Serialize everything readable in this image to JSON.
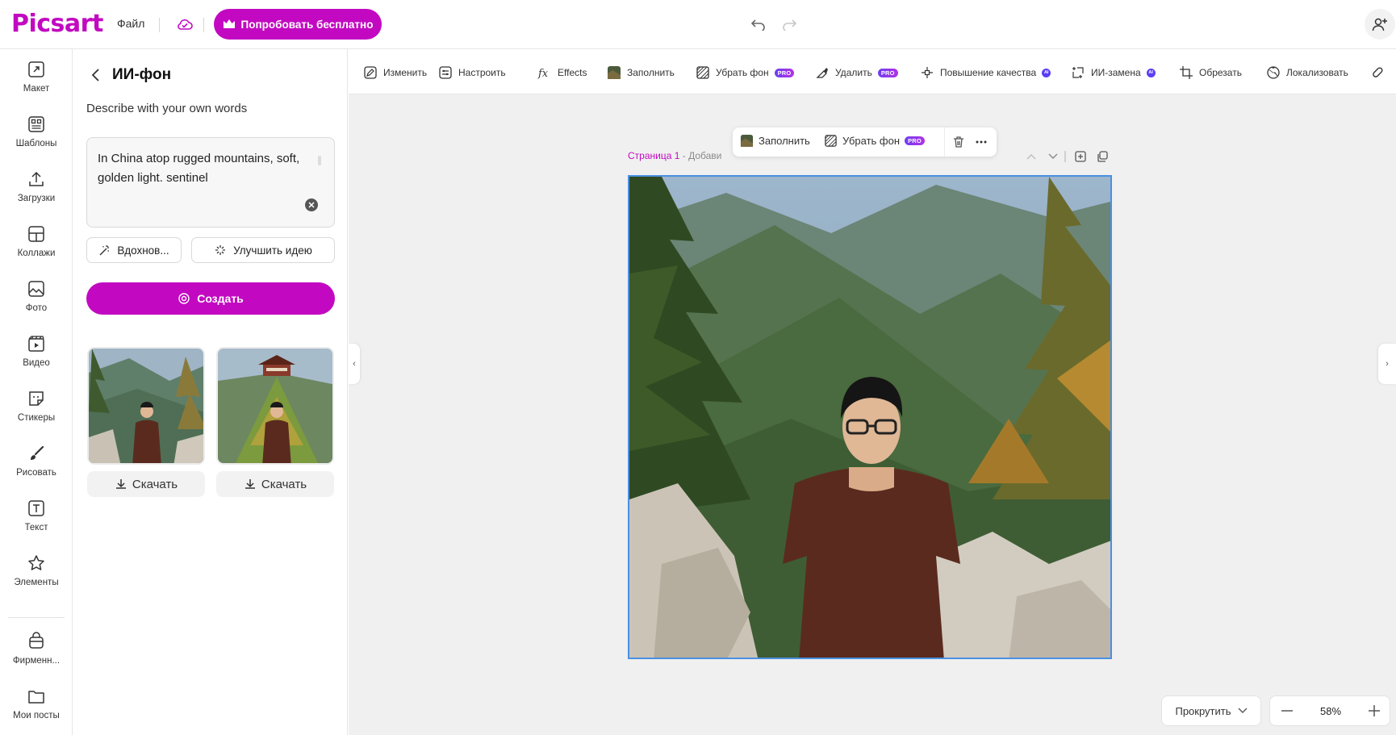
{
  "header": {
    "logo": "Picsart",
    "file_menu": "Файл",
    "try_free": "Попробовать бесплатно"
  },
  "left_nav": [
    {
      "label": "Макет",
      "icon": "layout-icon"
    },
    {
      "label": "Шаблоны",
      "icon": "templates-icon"
    },
    {
      "label": "Загрузки",
      "icon": "upload-icon"
    },
    {
      "label": "Коллажи",
      "icon": "collage-icon"
    },
    {
      "label": "Фото",
      "icon": "photo-icon"
    },
    {
      "label": "Видео",
      "icon": "video-icon"
    },
    {
      "label": "Стикеры",
      "icon": "sticker-icon"
    },
    {
      "label": "Рисовать",
      "icon": "brush-icon"
    },
    {
      "label": "Текст",
      "icon": "text-icon"
    },
    {
      "label": "Элементы",
      "icon": "star-icon"
    },
    {
      "label": "Фирменн...",
      "icon": "brand-kit-icon"
    },
    {
      "label": "Мои посты",
      "icon": "folder-icon"
    }
  ],
  "panel": {
    "title": "ИИ-фон",
    "subtitle": "Describe with your own words",
    "prompt_value": "In China atop rugged mountains, soft, golden light. sentinel",
    "inspire_label": "Вдохнов...",
    "improve_label": "Улучшить идею",
    "create_label": "Создать",
    "results": [
      {
        "download_label": "Скачать"
      },
      {
        "download_label": "Скачать"
      }
    ]
  },
  "toolbar": {
    "tools": [
      {
        "label": "Изменить",
        "icon": "edit-icon"
      },
      {
        "label": "Настроить",
        "icon": "adjust-icon"
      },
      {
        "label": "Effects",
        "icon": "fx-icon"
      },
      {
        "label": "Заполнить",
        "icon": "fill-icon"
      },
      {
        "label": "Убрать фон",
        "icon": "remove-bg-icon",
        "badge": "PRO"
      },
      {
        "label": "Удалить",
        "icon": "eraser-icon",
        "badge": "PRO"
      },
      {
        "label": "Повышение качества",
        "icon": "enhance-icon",
        "badge": "AI"
      },
      {
        "label": "ИИ-замена",
        "icon": "replace-icon",
        "badge": "AI"
      },
      {
        "label": "Обрезать",
        "icon": "crop-icon"
      },
      {
        "label": "Локализовать",
        "icon": "globe-icon"
      }
    ]
  },
  "canvas": {
    "page_label": "Страница 1",
    "page_add": " - Добави",
    "float_fill": "Заполнить",
    "float_remove_bg": "Убрать фон",
    "float_pro": "PRO",
    "scroll_label": "Прокрутить",
    "zoom": "58%"
  },
  "colors": {
    "brand": "#c209c1",
    "pro_badge": "#6d3ef0",
    "selection": "#4a90e2"
  }
}
